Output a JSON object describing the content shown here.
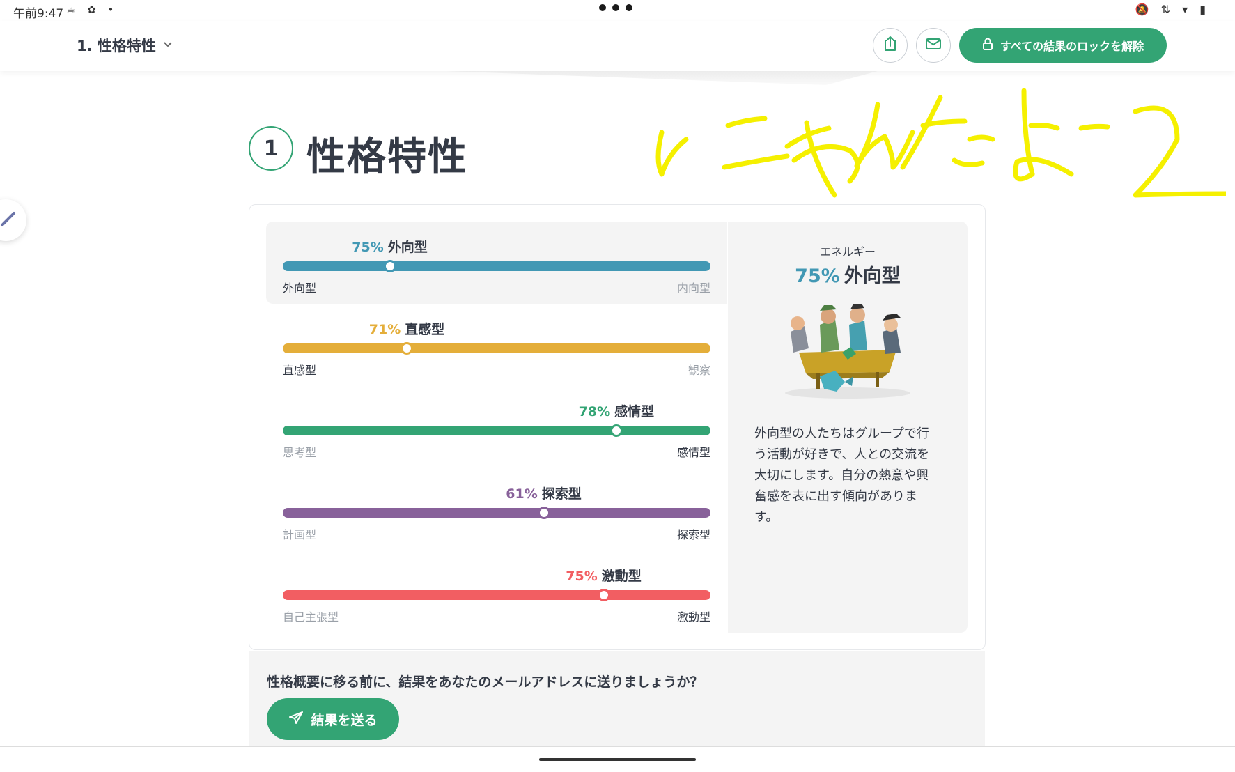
{
  "status_bar": {
    "time": "午前9:47",
    "left_icons": "☕ ✿ •",
    "right_icons": "🔕 ⇅ ▾ ▮"
  },
  "header": {
    "section_selector": "1. 性格特性",
    "unlock_label": "すべての結果のロックを解除",
    "accent_color": "#33a474"
  },
  "section": {
    "number": "1",
    "title": "性格特性"
  },
  "traits": [
    {
      "percent": "75%",
      "name": "外向型",
      "left_label": "外向型",
      "right_label": "内向型",
      "value": 0.25,
      "color": "#4298b4",
      "active_side": "left"
    },
    {
      "percent": "71%",
      "name": "直感型",
      "left_label": "直感型",
      "right_label": "観察",
      "value": 0.29,
      "color": "#e4ae3a",
      "active_side": "left"
    },
    {
      "percent": "78%",
      "name": "感情型",
      "left_label": "思考型",
      "right_label": "感情型",
      "value": 0.78,
      "color": "#33a474",
      "active_side": "right"
    },
    {
      "percent": "61%",
      "name": "探索型",
      "left_label": "計画型",
      "right_label": "探索型",
      "value": 0.61,
      "color": "#88619a",
      "active_side": "right"
    },
    {
      "percent": "75%",
      "name": "激動型",
      "left_label": "自己主張型",
      "right_label": "激動型",
      "value": 0.75,
      "color": "#f25e62",
      "active_side": "right"
    }
  ],
  "detail": {
    "category": "エネルギー",
    "percent": "75%",
    "name": "外向型",
    "description": "外向型の人たちはグループで行う活動が好きで、人との交流を大切にします。自分の熱意や興奮感を表に出す傾向があります。"
  },
  "bottom": {
    "question": "性格概要に移る前に、結果をあなたのメールアドレスに送りましょうか？",
    "send_label": "結果を送る"
  },
  "handwriting": {
    "color": "#f5f000"
  }
}
